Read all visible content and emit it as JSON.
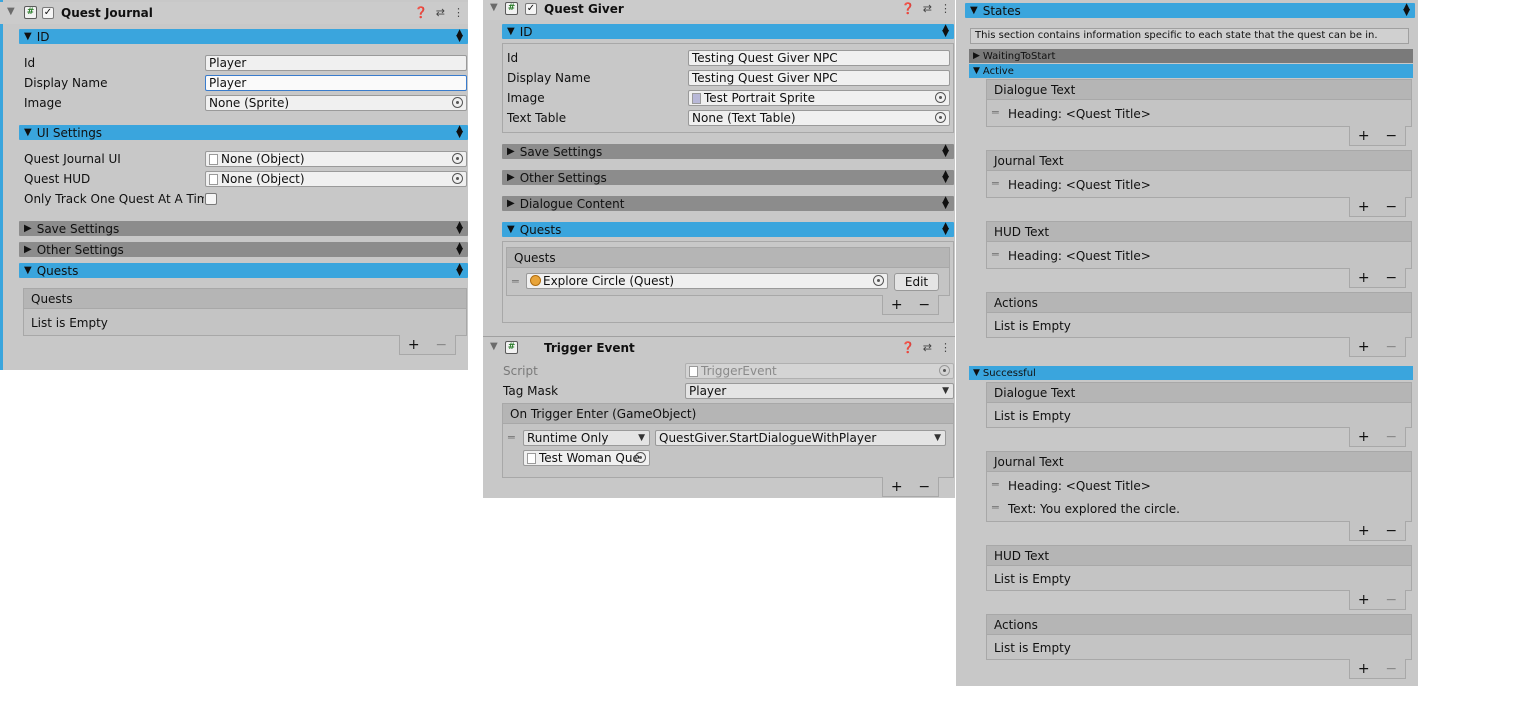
{
  "quest_journal": {
    "title": "Quest Journal",
    "id_section": "ID",
    "fields": [
      {
        "label": "Id",
        "value": "Player"
      },
      {
        "label": "Display Name",
        "value": "Player"
      },
      {
        "label": "Image",
        "value": "None (Sprite)"
      }
    ],
    "ui_section": "UI Settings",
    "ui_fields": [
      {
        "label": "Quest Journal UI",
        "value": "None (Object)"
      },
      {
        "label": "Quest HUD",
        "value": "None (Object)"
      },
      {
        "label": "Only Track One Quest At A Time"
      }
    ],
    "save_section": "Save Settings",
    "other_section": "Other Settings",
    "quests_section": "Quests",
    "quests_list_title": "Quests",
    "quests_list_empty": "List is Empty"
  },
  "quest_giver": {
    "title": "Quest Giver",
    "id_section": "ID",
    "fields": [
      {
        "label": "Id",
        "value": "Testing Quest Giver NPC"
      },
      {
        "label": "Display Name",
        "value": "Testing Quest Giver NPC"
      },
      {
        "label": "Image",
        "value": "Test Portrait Sprite"
      },
      {
        "label": "Text Table",
        "value": "None (Text Table)"
      }
    ],
    "save_section": "Save Settings",
    "other_section": "Other Settings",
    "dialogue_section": "Dialogue Content",
    "quests_section": "Quests",
    "quests_list_title": "Quests",
    "quest_item": "Explore Circle (Quest)",
    "edit_button": "Edit"
  },
  "trigger_event": {
    "title": "Trigger Event",
    "script_label": "Script",
    "script_value": "TriggerEvent",
    "tag_mask_label": "Tag Mask",
    "tag_mask_value": "Player",
    "event_title": "On Trigger Enter (GameObject)",
    "runtime_value": "Runtime Only",
    "function_value": "QuestGiver.StartDialogueWithPlayer",
    "object_value": "Test Woman Que"
  },
  "states": {
    "title": "States",
    "help": "This section contains information specific to each state that the quest can be in.",
    "waiting": "WaitingToStart",
    "active": "Active",
    "active_dialogue_title": "Dialogue Text",
    "active_dialogue_item": "Heading: <Quest Title>",
    "active_journal_title": "Journal Text",
    "active_journal_item": "Heading: <Quest Title>",
    "active_hud_title": "HUD Text",
    "active_hud_item": "Heading: <Quest Title>",
    "active_actions_title": "Actions",
    "active_actions_empty": "List is Empty",
    "successful": "Successful",
    "succ_dialogue_title": "Dialogue Text",
    "succ_dialogue_empty": "List is Empty",
    "succ_journal_title": "Journal Text",
    "succ_journal_item1": "Heading: <Quest Title>",
    "succ_journal_item2": "Text: You explored the circle.",
    "succ_hud_title": "HUD Text",
    "succ_hud_empty": "List is Empty",
    "succ_actions_title": "Actions",
    "succ_actions_empty": "List is Empty"
  },
  "colors": {
    "accent": "#3aa5dd",
    "panel": "#c8c8c8",
    "collapsed": "#8c8c8c"
  }
}
